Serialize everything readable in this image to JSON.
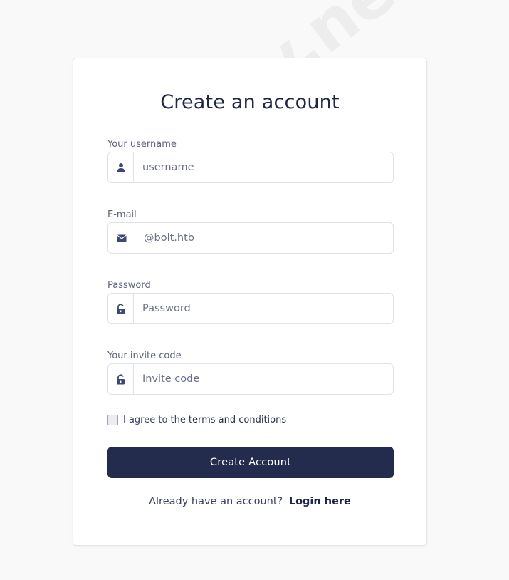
{
  "form": {
    "title": "Create an account",
    "fields": [
      {
        "label": "Your username",
        "placeholder": "username",
        "icon": "user-icon"
      },
      {
        "label": "E-mail",
        "placeholder": "@bolt.htb",
        "icon": "envelope-icon"
      },
      {
        "label": "Password",
        "placeholder": "Password",
        "icon": "unlock-icon"
      },
      {
        "label": "Your invite code",
        "placeholder": "Invite code",
        "icon": "unlock-icon"
      }
    ],
    "terms_prefix": "I agree to the",
    "terms_link": "terms and conditions",
    "submit_label": "Create Account",
    "footer_text": "Already have an account?",
    "footer_link": "Login here"
  },
  "watermark": "codeby.net",
  "colors": {
    "primary": "#232c4d",
    "icon": "#3f4775",
    "background": "#f9f9f9"
  }
}
